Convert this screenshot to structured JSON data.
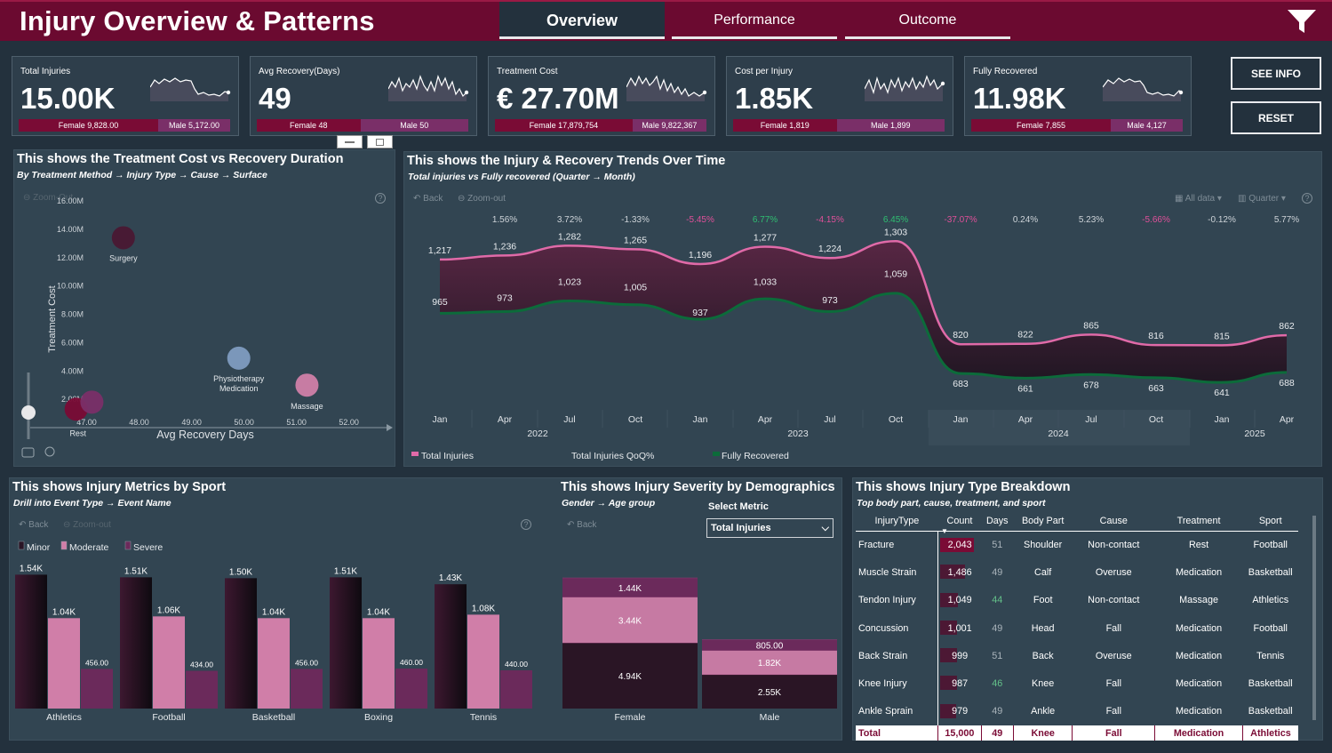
{
  "header": {
    "title": "Injury Overview & Patterns",
    "tabs": [
      {
        "label": "Overview",
        "active": true
      },
      {
        "label": "Performance"
      },
      {
        "label": "Outcome"
      }
    ],
    "bg": "#6b0a30"
  },
  "kpis": [
    {
      "label": "Total Injuries",
      "value": "15.00K",
      "female": "Female 9,828.00",
      "male": "Male 5,172.00",
      "female_share": 0.655
    },
    {
      "label": "Avg Recovery(Days)",
      "value": "49",
      "female": "Female 48",
      "male": "Male 50",
      "female_share": 0.49
    },
    {
      "label": "Treatment Cost",
      "value": "€ 27.70M",
      "female": "Female 17,879,754",
      "male": "Male 9,822,367",
      "female_share": 0.645
    },
    {
      "label": "Cost per Injury",
      "value": "1.85K",
      "female": "Female 1,819",
      "male": "Male 1,899",
      "female_share": 0.49
    },
    {
      "label": "Fully Recovered",
      "value": "11.98K",
      "female": "Female 7,855",
      "male": "Male 4,127",
      "female_share": 0.655
    }
  ],
  "buttons": {
    "see_info": "SEE INFO",
    "reset": "RESET"
  },
  "scatter": {
    "title": "This shows the Treatment Cost vs Recovery Duration",
    "subtitle": "By Treatment Method → Injury Type → Cause → Surface",
    "zoom_out": "Zoom-Out",
    "help": "?",
    "chart_data": {
      "type": "scatter",
      "xlabel": "Avg Recovery Days",
      "ylabel": "Treatment Cost",
      "xlim": [
        46.5,
        52.7
      ],
      "ylim": [
        0,
        16000000
      ],
      "x_ticks": [
        "47.00",
        "48.00",
        "49.00",
        "50.00",
        "51.00",
        "52.00"
      ],
      "y_ticks": [
        "2.00M",
        "4.00M",
        "6.00M",
        "8.00M",
        "10.00M",
        "12.00M",
        "14.00M",
        "16.00M"
      ],
      "points": [
        {
          "name": "Surgery",
          "x": 47.7,
          "y": 13400000,
          "color": "#4a1833",
          "r": 13
        },
        {
          "name": "Physiotherapy",
          "x": 49.9,
          "y": 4900000,
          "color": "#7f9cc0",
          "r": 13
        },
        {
          "name": "Medication",
          "x": 49.9,
          "y": 3700000,
          "color": "#6a3158",
          "r": 0
        },
        {
          "name": "Massage",
          "x": 51.2,
          "y": 3000000,
          "color": "#d080a8",
          "r": 13
        },
        {
          "name": "Rest",
          "x": 46.8,
          "y": 1300000,
          "color": "#7a0b35",
          "r": 13
        },
        {
          "name": "",
          "x": 47.1,
          "y": 1800000,
          "color": "#7a2f68",
          "r": 13
        }
      ]
    }
  },
  "trend": {
    "title": "This shows the Injury & Recovery Trends Over Time",
    "subtitle": "Total injuries vs Fully recovered (Quarter → Month)",
    "back": "Back",
    "zoom_out": "Zoom-out",
    "all_data": "All data",
    "quarter": "Quarter",
    "chart_data": {
      "type": "line",
      "x": [
        "Jan",
        "Apr",
        "Jul",
        "Oct",
        "Jan",
        "Apr",
        "Jul",
        "Oct",
        "Jan",
        "Apr",
        "Jul",
        "Oct",
        "Jan",
        "Apr"
      ],
      "years": [
        "2022",
        "2023",
        "2024",
        "2025"
      ],
      "series": [
        {
          "name": "Total Injuries",
          "values": [
            1217,
            1236,
            1282,
            1265,
            1196,
            1277,
            1224,
            1303,
            820,
            822,
            865,
            816,
            815,
            862
          ],
          "color": "#e06aa8"
        },
        {
          "name": "Fully Recovered",
          "values": [
            965,
            973,
            1023,
            1005,
            937,
            1033,
            973,
            1059,
            683,
            661,
            678,
            663,
            641,
            688
          ],
          "color": "#0c6b3a"
        }
      ],
      "qoq_label": "Total Injuries QoQ%",
      "qoq": [
        "1.56%",
        "3.72%",
        "-1.33%",
        "-5.45%",
        "6.77%",
        "-4.15%",
        "6.45%",
        "-37.07%",
        "0.24%",
        "5.23%",
        "-5.66%",
        "-0.12%",
        "5.77%"
      ],
      "ylim": [
        500,
        1450
      ]
    }
  },
  "sport": {
    "title": "This shows Injury Metrics by Sport",
    "subtitle": "Drill into Event Type → Event Name",
    "back": "Back",
    "zoom_out": "Zoom-out",
    "chart_data": {
      "type": "bar",
      "categories": [
        "Athletics",
        "Football",
        "Basketball",
        "Boxing",
        "Tennis"
      ],
      "series": [
        {
          "name": "Minor",
          "values": [
            1540,
            1510,
            1500,
            1510,
            1430
          ],
          "labels": [
            "1.54K",
            "1.51K",
            "1.50K",
            "1.51K",
            "1.43K"
          ],
          "color": "#2a1525"
        },
        {
          "name": "Moderate",
          "values": [
            1040,
            1060,
            1040,
            1040,
            1080
          ],
          "labels": [
            "1.04K",
            "1.06K",
            "1.04K",
            "1.04K",
            "1.08K"
          ],
          "color": "#d07ea8"
        },
        {
          "name": "Severe",
          "values": [
            456,
            434,
            456,
            460,
            440
          ],
          "labels": [
            "456.00",
            "434.00",
            "456.00",
            "460.00",
            "440.00"
          ],
          "color": "#6b2a5b"
        }
      ],
      "ylim": [
        0,
        1800
      ]
    }
  },
  "demog": {
    "title": "This shows Injury Severity by Demographics",
    "subtitle": "Gender → Age group",
    "back": "Back",
    "select_label": "Select Metric",
    "select_value": "Total Injuries",
    "chart_data": {
      "type": "bar",
      "categories": [
        "Female",
        "Male"
      ],
      "stacked": true,
      "series": [
        {
          "name": "bottom",
          "values": [
            4940,
            2550
          ],
          "labels": [
            "4.94K",
            "2.55K"
          ],
          "color": "#2a1525"
        },
        {
          "name": "middle",
          "values": [
            3440,
            1820
          ],
          "labels": [
            "3.44K",
            "1.82K"
          ],
          "color": "#c67aa3"
        },
        {
          "name": "top",
          "values": [
            1440,
            805
          ],
          "labels": [
            "1.44K",
            "805.00"
          ],
          "color": "#6b2a5b"
        }
      ]
    }
  },
  "breakdown": {
    "title": "This shows Injury Type Breakdown",
    "subtitle": "Top body part, cause, treatment, and sport",
    "columns": [
      "InjuryType",
      "Count",
      "Days",
      "Body Part",
      "Cause",
      "Treatment",
      "Sport"
    ],
    "rows": [
      {
        "type": "Fracture",
        "count": "2,043",
        "count_v": 2043,
        "days": "51",
        "body": "Shoulder",
        "cause": "Non-contact",
        "treatment": "Rest",
        "sport": "Football"
      },
      {
        "type": "Muscle Strain",
        "count": "1,486",
        "count_v": 1486,
        "days": "49",
        "body": "Calf",
        "cause": "Overuse",
        "treatment": "Medication",
        "sport": "Basketball"
      },
      {
        "type": "Tendon Injury",
        "count": "1,049",
        "count_v": 1049,
        "days": "44",
        "body": "Foot",
        "cause": "Non-contact",
        "treatment": "Massage",
        "sport": "Athletics"
      },
      {
        "type": "Concussion",
        "count": "1,001",
        "count_v": 1001,
        "days": "49",
        "body": "Head",
        "cause": "Fall",
        "treatment": "Medication",
        "sport": "Football"
      },
      {
        "type": "Back Strain",
        "count": "999",
        "count_v": 999,
        "days": "51",
        "body": "Back",
        "cause": "Overuse",
        "treatment": "Medication",
        "sport": "Tennis"
      },
      {
        "type": "Knee Injury",
        "count": "987",
        "count_v": 987,
        "days": "46",
        "body": "Knee",
        "cause": "Fall",
        "treatment": "Medication",
        "sport": "Basketball"
      },
      {
        "type": "Ankle Sprain",
        "count": "979",
        "count_v": 979,
        "days": "49",
        "body": "Ankle",
        "cause": "Fall",
        "treatment": "Medication",
        "sport": "Basketball"
      }
    ],
    "total": {
      "type": "Total",
      "count": "15,000",
      "days": "49",
      "body": "Knee",
      "cause": "Fall",
      "treatment": "Medication",
      "sport": "Athletics"
    }
  }
}
